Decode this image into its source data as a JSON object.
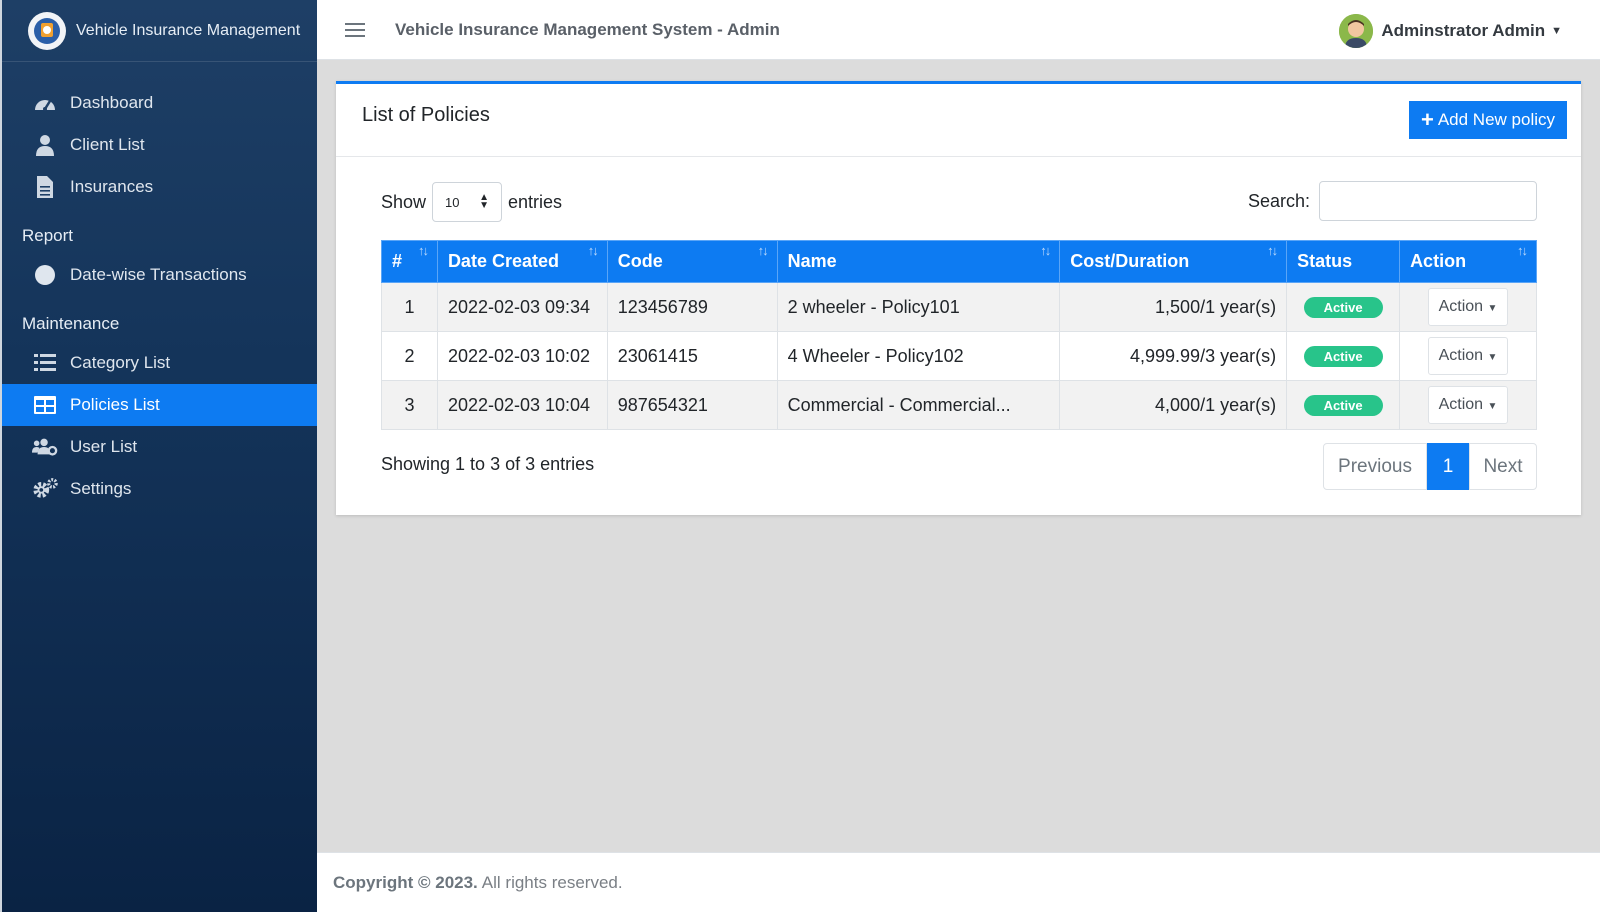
{
  "brand": {
    "title": "Vehicle Insurance Management"
  },
  "topbar": {
    "title": "Vehicle Insurance Management System - Admin",
    "user": "Adminstrator Admin"
  },
  "sidebar": {
    "items": [
      {
        "label": "Dashboard",
        "icon": "dashboard-icon"
      },
      {
        "label": "Client List",
        "icon": "user-icon"
      },
      {
        "label": "Insurances",
        "icon": "file-icon"
      }
    ],
    "report_header": "Report",
    "report_items": [
      {
        "label": "Date-wise Transactions",
        "icon": "circle-icon"
      }
    ],
    "maintenance_header": "Maintenance",
    "maintenance_items": [
      {
        "label": "Category List",
        "icon": "list-icon"
      },
      {
        "label": "Policies List",
        "icon": "table-icon",
        "active": true
      },
      {
        "label": "User List",
        "icon": "users-gear-icon"
      },
      {
        "label": "Settings",
        "icon": "gears-icon"
      }
    ]
  },
  "card": {
    "title": "List of Policies",
    "add_button": "Add New policy",
    "show_label": "Show",
    "entries_label": "entries",
    "page_length": "10",
    "search_label": "Search:",
    "search_value": ""
  },
  "table": {
    "columns": [
      "#",
      "Date Created",
      "Code",
      "Name",
      "Cost/Duration",
      "Status",
      "Action"
    ],
    "rows": [
      {
        "no": "1",
        "date": "2022-02-03 09:34",
        "code": "123456789",
        "name": "2 wheeler - Policy101",
        "cost": "1,500/1 year(s)",
        "status": "Active",
        "action": "Action"
      },
      {
        "no": "2",
        "date": "2022-02-03 10:02",
        "code": "23061415",
        "name": "4 Wheeler - Policy102",
        "cost": "4,999.99/3 year(s)",
        "status": "Active",
        "action": "Action"
      },
      {
        "no": "3",
        "date": "2022-02-03 10:04",
        "code": "987654321",
        "name": "Commercial - Commercial...",
        "cost": "4,000/1 year(s)",
        "status": "Active",
        "action": "Action"
      }
    ]
  },
  "pagination": {
    "info": "Showing 1 to 3 of 3 entries",
    "previous": "Previous",
    "current": "1",
    "next": "Next"
  },
  "footer": {
    "copyright": "Copyright © 2023.",
    "rights": "All rights reserved."
  },
  "colors": {
    "primary": "#0d7bf2",
    "sidebar": "#14345a",
    "success": "#28c48a"
  }
}
